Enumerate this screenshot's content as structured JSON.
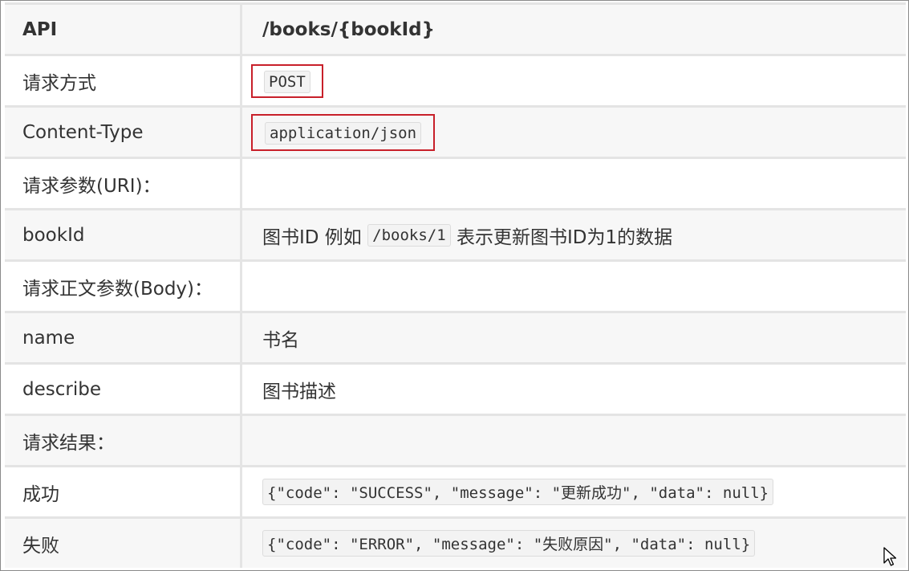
{
  "table": {
    "header": {
      "key": "API",
      "value": "/books/{bookId}"
    },
    "method": {
      "label": "请求方式",
      "value": "POST"
    },
    "content_type": {
      "label": "Content-Type",
      "value": "application/json"
    },
    "uri_params": {
      "label": "请求参数(URI)："
    },
    "book_id": {
      "label": "bookId",
      "text_before": "图书ID 例如 ",
      "code": "/books/1",
      "text_after": " 表示更新图书ID为1的数据"
    },
    "body_params": {
      "label": "请求正文参数(Body)："
    },
    "name": {
      "label": "name",
      "value": "书名"
    },
    "describe": {
      "label": "describe",
      "value": "图书描述"
    },
    "result": {
      "label": "请求结果："
    },
    "success": {
      "label": "成功",
      "value": "{\"code\": \"SUCCESS\", \"message\": \"更新成功\", \"data\": null}"
    },
    "failure": {
      "label": "失败",
      "value": "{\"code\": \"ERROR\", \"message\": \"失败原因\", \"data\": null}"
    }
  },
  "colors": {
    "highlight_border": "#c8202a",
    "row_shade": "#f7f7f7",
    "grid": "#e4e4e4"
  },
  "icons": {
    "cursor": "mouse-pointer-icon"
  }
}
